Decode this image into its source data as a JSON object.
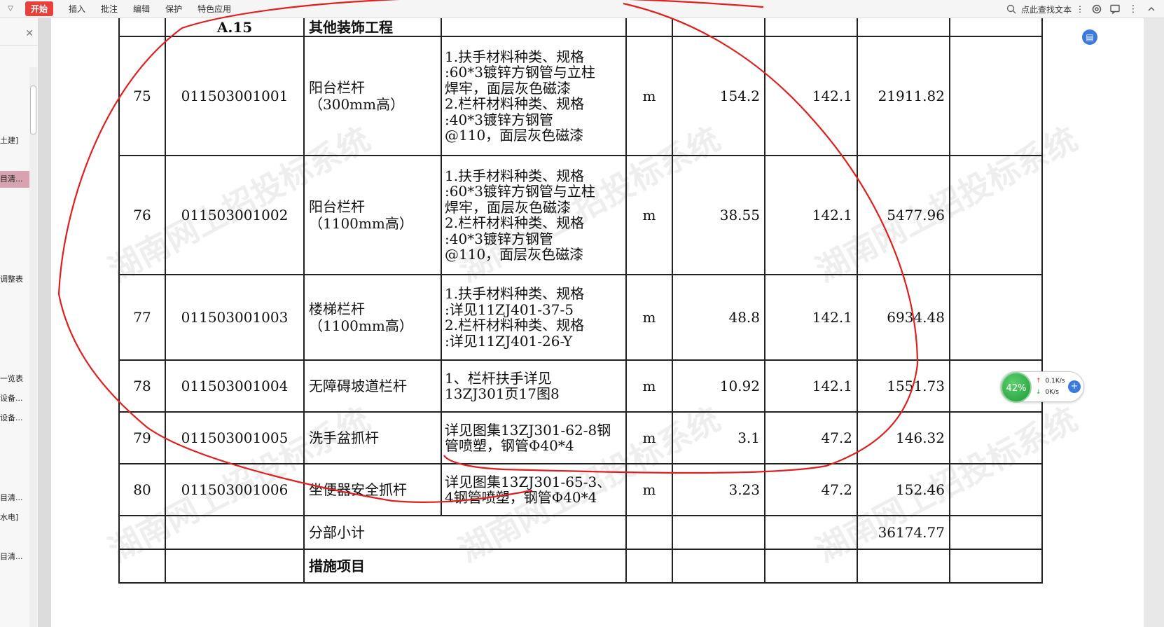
{
  "toolbar": {
    "start_label": "开始",
    "items": [
      "插入",
      "批注",
      "编辑",
      "保护",
      "特色应用"
    ],
    "search_placeholder": "点此查找文本",
    "more": "⋮"
  },
  "nav": {
    "items": [
      {
        "label": "土建]"
      },
      {
        "label": "目清..."
      },
      {
        "label": "调整表"
      },
      {
        "label": "一览表"
      },
      {
        "label": "设备..."
      },
      {
        "label": "设备..."
      },
      {
        "label": "目清..."
      },
      {
        "label": "水电]"
      },
      {
        "label": "目清..."
      }
    ]
  },
  "table": {
    "section_row": {
      "no": "A.15",
      "name": "其他装饰工程"
    },
    "rows": [
      {
        "no": "75",
        "code": "011503001001",
        "name": "阳台栏杆\n（300mm高）",
        "desc": "1.扶手材料种类、规格\n:60*3镀锌方钢管与立柱\n焊牢，面层灰色磁漆\n2.栏杆材料种类、规格\n:40*3镀锌方钢管\n@110，面层灰色磁漆",
        "unit": "m",
        "qty": "154.2",
        "price": "142.1",
        "total": "21911.82"
      },
      {
        "no": "76",
        "code": "011503001002",
        "name": "阳台栏杆\n（1100mm高）",
        "desc": "1.扶手材料种类、规格\n:60*3镀锌方钢管与立柱\n焊牢，面层灰色磁漆\n2.栏杆材料种类、规格\n:40*3镀锌方钢管\n@110，面层灰色磁漆",
        "unit": "m",
        "qty": "38.55",
        "price": "142.1",
        "total": "5477.96"
      },
      {
        "no": "77",
        "code": "011503001003",
        "name": "楼梯栏杆\n（1100mm高）",
        "desc": "1.扶手材料种类、规格\n:详见11ZJ401-37-5\n2.栏杆材料种类、规格\n:详见11ZJ401-26-Y",
        "unit": "m",
        "qty": "48.8",
        "price": "142.1",
        "total": "6934.48"
      },
      {
        "no": "78",
        "code": "011503001004",
        "name": "无障碍坡道栏杆",
        "desc": "1、栏杆扶手详见\n13ZJ301页17图8",
        "unit": "m",
        "qty": "10.92",
        "price": "142.1",
        "total": "1551.73"
      },
      {
        "no": "79",
        "code": "011503001005",
        "name": "洗手盆抓杆",
        "desc": "详见图集13ZJ301-62-8钢\n管喷塑，钢管Φ40*4",
        "unit": "m",
        "qty": "3.1",
        "price": "47.2",
        "total": "146.32"
      },
      {
        "no": "80",
        "code": "011503001006",
        "name": "坐便器安全抓杆",
        "desc": "详见图集13ZJ301-65-3、\n4钢管喷塑，钢管Φ40*4",
        "unit": "m",
        "qty": "3.23",
        "price": "47.2",
        "total": "152.46"
      }
    ],
    "subtotal": {
      "label": "分部小计",
      "total": "36174.77"
    },
    "measures": {
      "label": "措施项目"
    }
  },
  "watermark_text": "湖南网上招投标系统",
  "speed_widget": {
    "percent": "42%",
    "up": "0.1K/s",
    "down": "0K/s",
    "up_arrow": "↑",
    "down_arrow": "↓",
    "plus": "+"
  },
  "colors": {
    "start_button": "#e8413c",
    "annotation": "#e02020",
    "nav_selected": "#d8a3b0"
  }
}
